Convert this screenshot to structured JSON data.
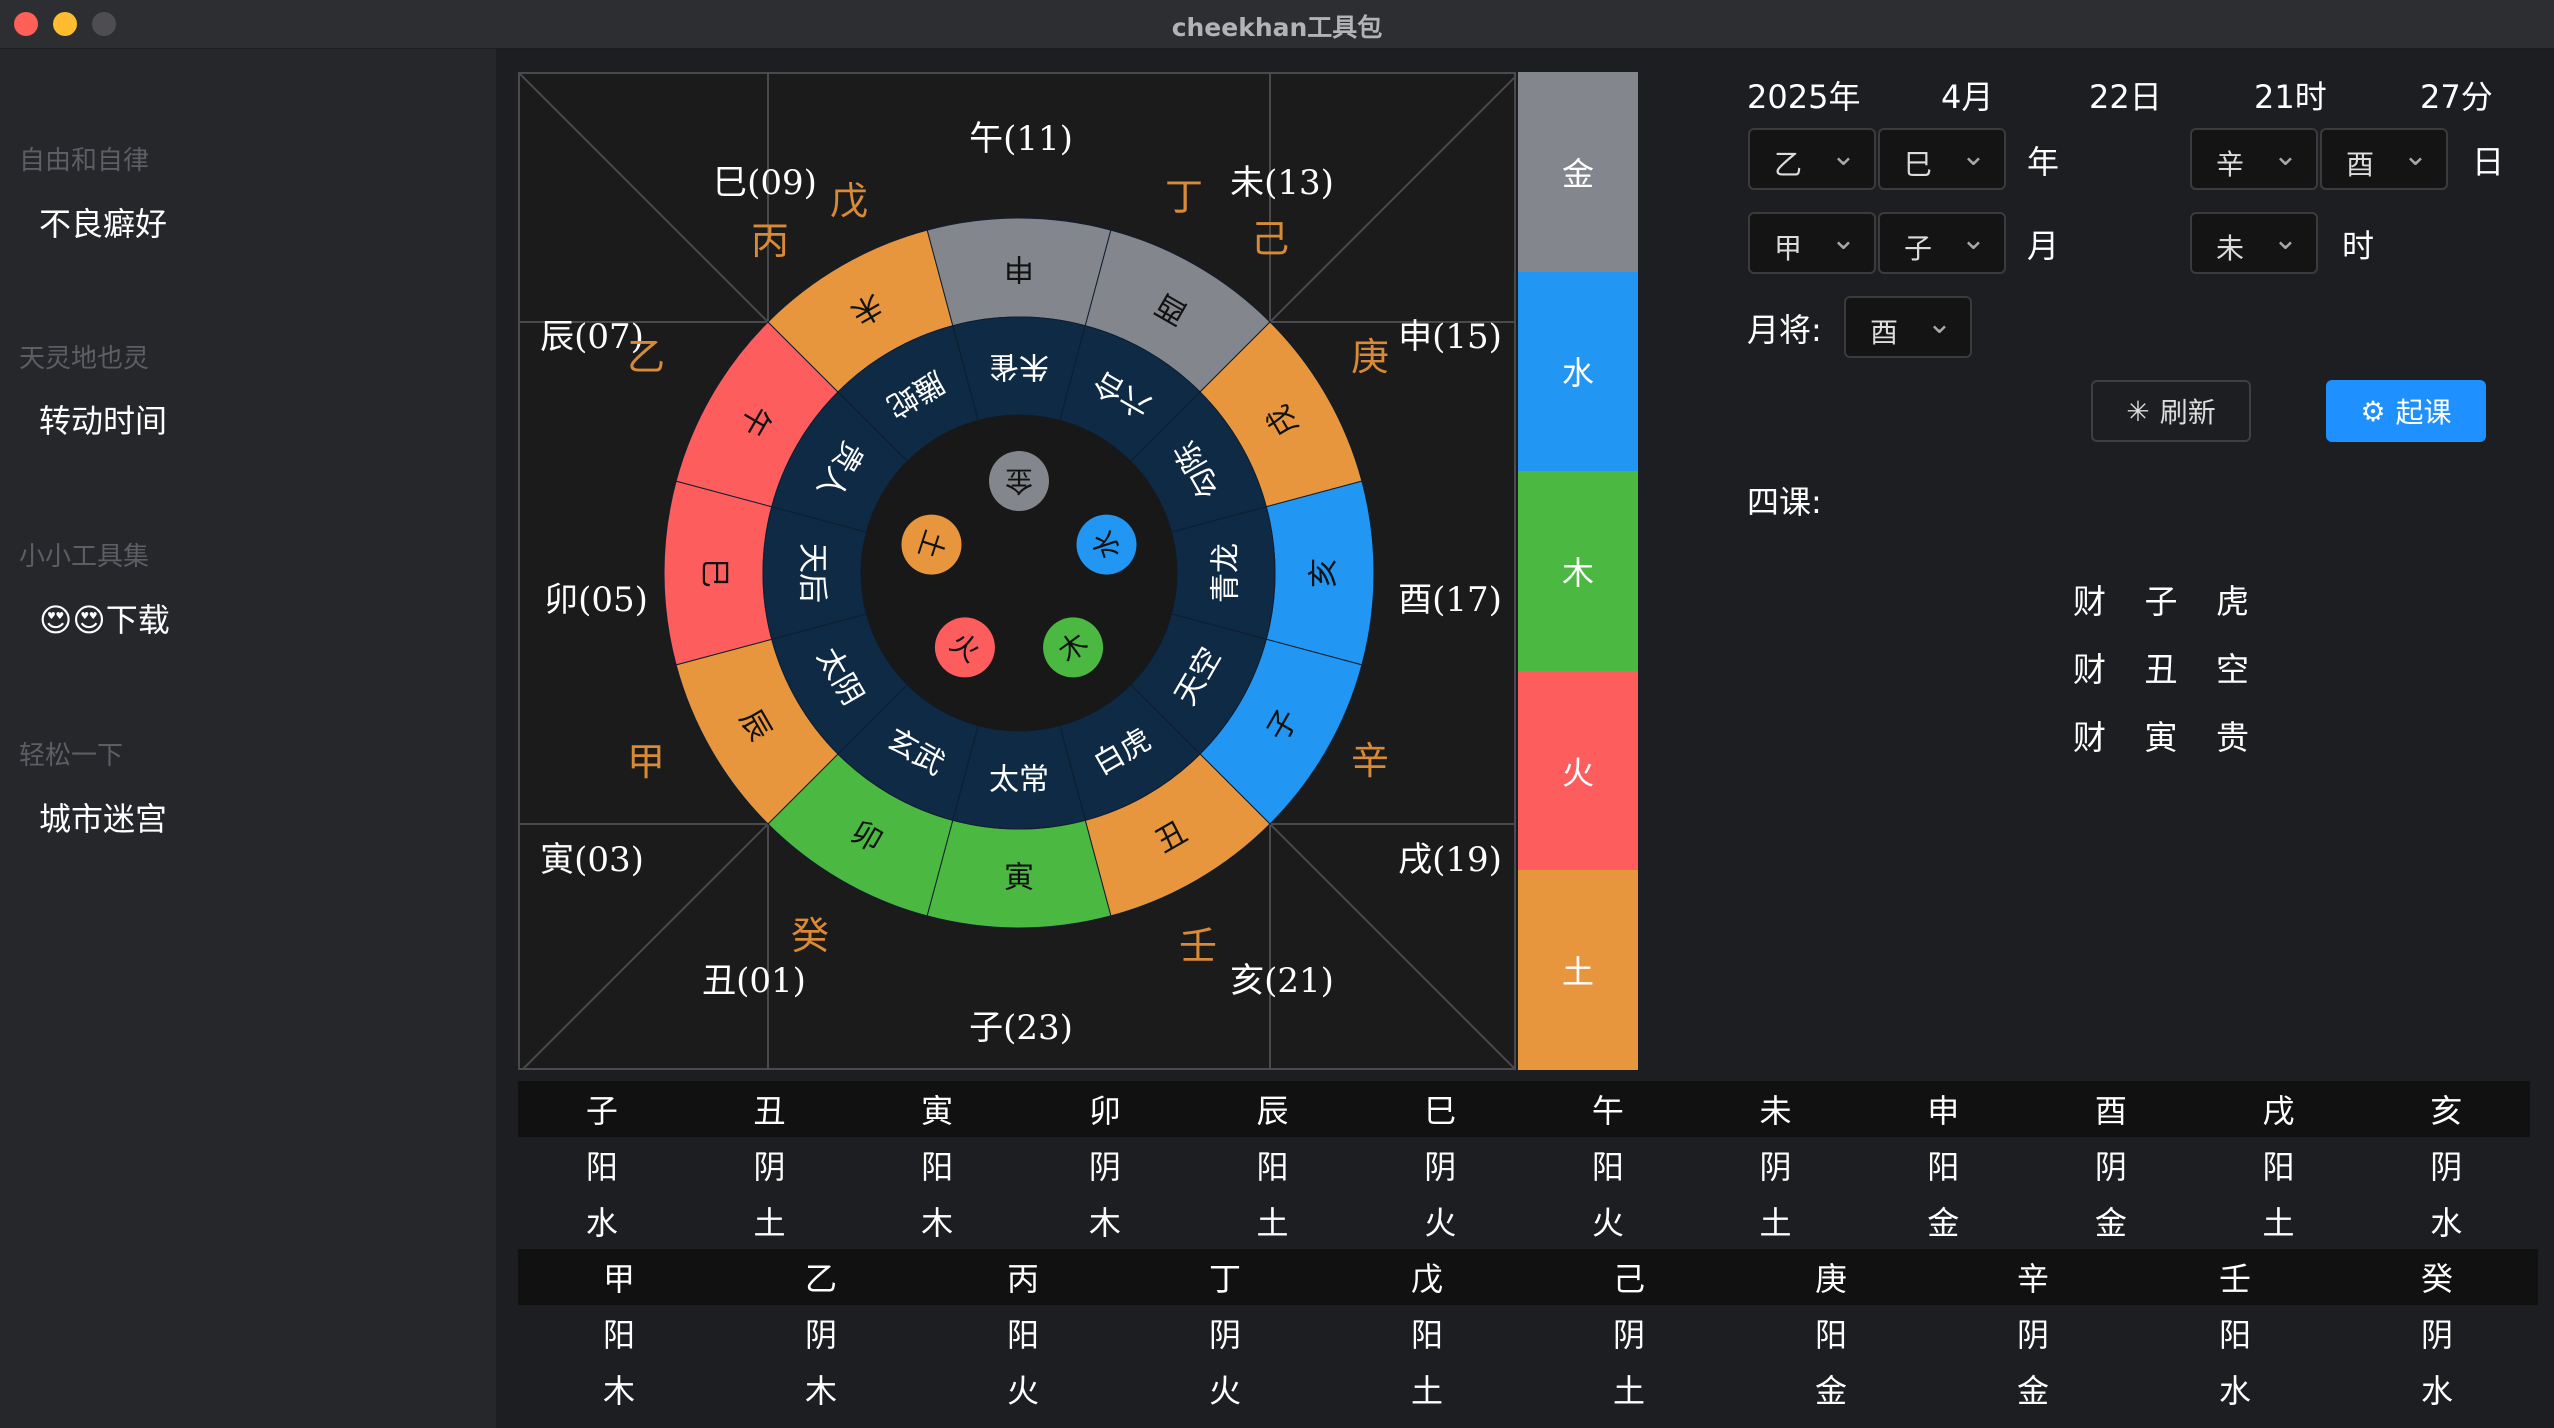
{
  "window": {
    "title": "cheekhan工具包"
  },
  "sidebar": {
    "groups": [
      {
        "title": "自由和自律",
        "items": [
          "不良癖好"
        ]
      },
      {
        "title": "天灵地也灵",
        "items": [
          "转动时间"
        ]
      },
      {
        "title": "小小工具集",
        "items": [
          "😍😍下载"
        ]
      },
      {
        "title": "轻松一下",
        "items": [
          "城市迷宫"
        ]
      }
    ]
  },
  "board": {
    "branch_labels": [
      "午(11)",
      "未(13)",
      "申(15)",
      "酉(17)",
      "戌(19)",
      "亥(21)",
      "子(23)",
      "丑(01)",
      "寅(03)",
      "卯(05)",
      "辰(07)",
      "巳(09)"
    ],
    "stem_labels": [
      "丁",
      "己",
      "庚",
      "辛",
      "壬",
      "癸",
      "甲",
      "乙",
      "丙",
      "戊"
    ],
    "outer_ring": [
      "申",
      "酉",
      "戌",
      "亥",
      "子",
      "丑",
      "寅",
      "卯",
      "辰",
      "巳",
      "午",
      "未"
    ],
    "inner_ring": [
      "朱雀",
      "六合",
      "勾陈",
      "青龙",
      "天空",
      "白虎",
      "太常",
      "玄武",
      "太阴",
      "天后",
      "贵人",
      "螣蛇"
    ],
    "center": [
      "金",
      "水",
      "木",
      "火",
      "土"
    ]
  },
  "elements": [
    "金",
    "水",
    "木",
    "火",
    "土"
  ],
  "colors": {
    "metal": "#83868c",
    "water": "#2196f3",
    "wood": "#4bb842",
    "fire": "#fe5d5d",
    "earth": "#e8963e",
    "ring_inner": "#0f2a45",
    "ring_center": "#181818",
    "stem_text": "#d98a36",
    "accent": "#1e90ff"
  },
  "controls": {
    "year": "2025年",
    "month": "4月",
    "day": "22日",
    "hour": "21时",
    "minute": "27分",
    "year_gan": "乙",
    "year_zhi": "巳",
    "year_label": "年",
    "day_gan": "辛",
    "day_zhi": "酉",
    "day_label": "日",
    "month_gan": "甲",
    "month_zhi": "子",
    "month_label": "月",
    "hour_zhi": "未",
    "hour_label": "时",
    "yuejiang_label": "月将:",
    "yuejiang": "酉",
    "refresh_label": "刷新",
    "start_label": "起课",
    "sike_label": "四课:",
    "sike": [
      "财 子 虎",
      "财 丑 空",
      "财 寅 贵"
    ]
  },
  "table_branches": {
    "names": [
      "子",
      "丑",
      "寅",
      "卯",
      "辰",
      "巳",
      "午",
      "未",
      "申",
      "酉",
      "戌",
      "亥"
    ],
    "yinyang": [
      "阳",
      "阴",
      "阳",
      "阴",
      "阳",
      "阴",
      "阳",
      "阴",
      "阳",
      "阴",
      "阳",
      "阴"
    ],
    "wuxing": [
      "水",
      "土",
      "木",
      "木",
      "土",
      "火",
      "火",
      "土",
      "金",
      "金",
      "土",
      "水"
    ]
  },
  "table_stems": {
    "names": [
      "甲",
      "乙",
      "丙",
      "丁",
      "戊",
      "己",
      "庚",
      "辛",
      "壬",
      "癸"
    ],
    "yinyang": [
      "阳",
      "阴",
      "阳",
      "阴",
      "阳",
      "阴",
      "阳",
      "阴",
      "阳",
      "阴"
    ],
    "wuxing": [
      "木",
      "木",
      "火",
      "火",
      "土",
      "土",
      "金",
      "金",
      "水",
      "水"
    ]
  }
}
